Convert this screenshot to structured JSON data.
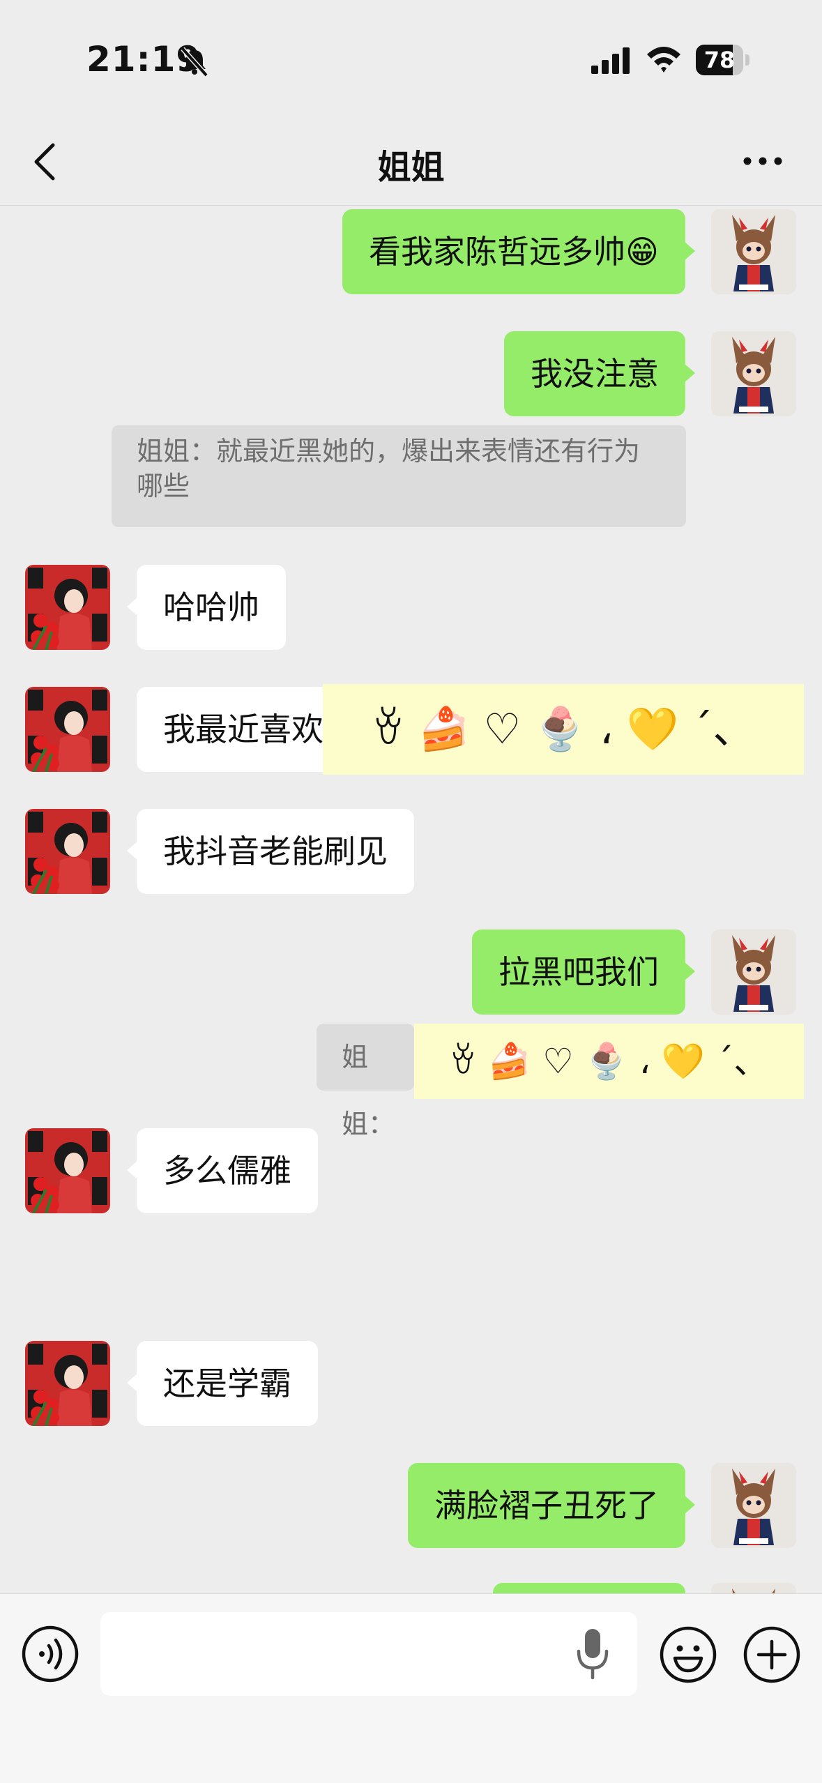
{
  "status_bar": {
    "time": "21:19",
    "battery_level": "78",
    "battery_fraction": 0.78
  },
  "header": {
    "title": "姐姐",
    "back_icon": "chevron-left-icon",
    "more_icon": "more-icon"
  },
  "messages": [
    {
      "side": "me",
      "text": "看我家陈哲远多帅😁"
    },
    {
      "side": "me",
      "text": "我没注意"
    },
    {
      "side": "quote",
      "text": "姐姐：就最近黑她的，爆出来表情还有行为哪些"
    },
    {
      "side": "them",
      "text": "哈哈帅"
    },
    {
      "side": "them",
      "text": "我最近喜欢"
    },
    {
      "side": "sticker",
      "text": "ꈊ 🍰 ♡ 🍨 ، 💛 ˊ、"
    },
    {
      "side": "them",
      "text": "我抖音老能刷见"
    },
    {
      "side": "me",
      "text": "拉黑吧我们"
    },
    {
      "side": "quote",
      "text": "姐姐："
    },
    {
      "side": "sticker",
      "text": "ꈊ 🍰 ♡ 🍨 ، 💛 ˊ、"
    },
    {
      "side": "them",
      "text": "多么儒雅"
    },
    {
      "side": "them",
      "text": "还是学霸"
    },
    {
      "side": "me",
      "text": "满脸褶子丑死了"
    }
  ],
  "input_bar": {
    "text": "",
    "icons": [
      "voice-icon",
      "mic-icon",
      "emoji-icon",
      "plus-icon"
    ]
  },
  "colors": {
    "background": "#ededed",
    "my_bubble": "#95ec69",
    "their_bubble": "#ffffff",
    "quote_bg": "#dcdcdc",
    "sticker_bg": "#fdfccb"
  }
}
